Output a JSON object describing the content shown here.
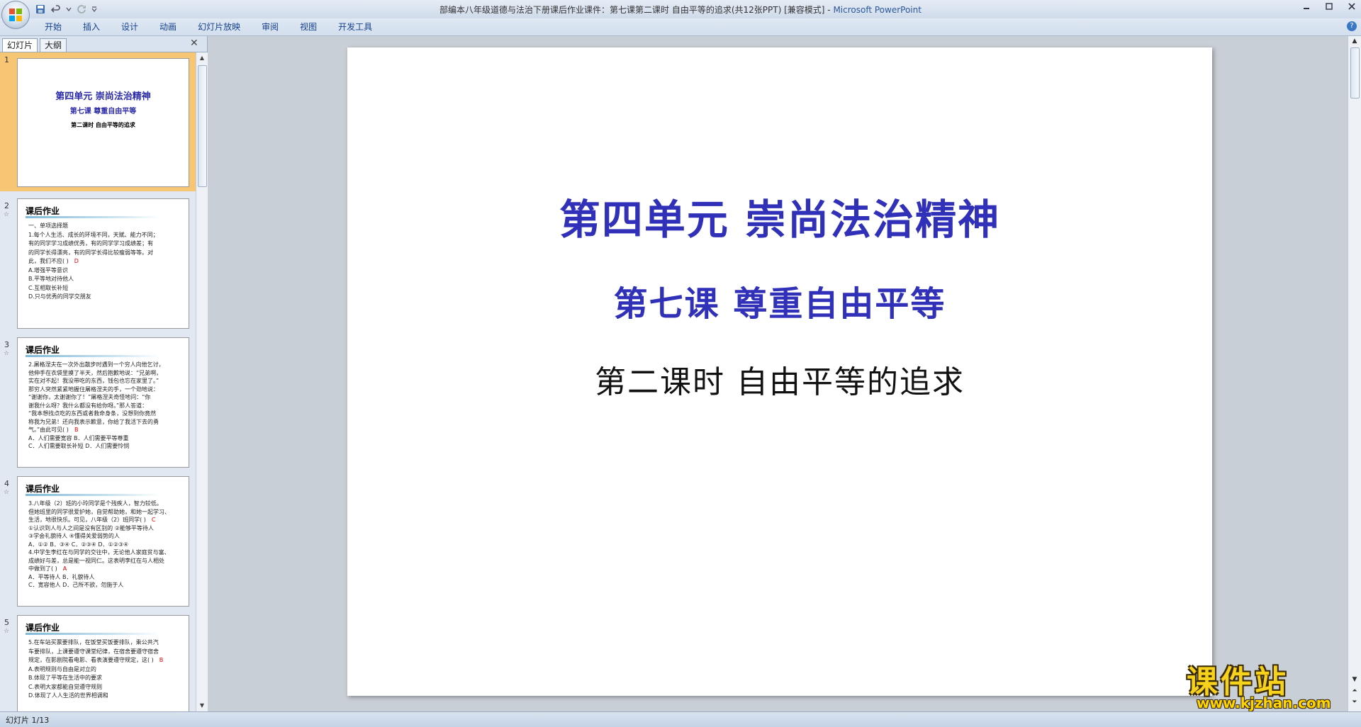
{
  "window": {
    "title": "部编本八年级道德与法治下册课后作业课件：第七课第二课时 自由平等的追求(共12张PPT) [兼容模式]",
    "app_name": "Microsoft PowerPoint"
  },
  "ribbon_tabs": [
    "开始",
    "插入",
    "设计",
    "动画",
    "幻灯片放映",
    "审阅",
    "视图",
    "开发工具"
  ],
  "pane": {
    "tab_slides": "幻灯片",
    "tab_outline": "大纲"
  },
  "thumbnails": {
    "s1": {
      "num": "1",
      "line1": "第四单元  崇尚法治精神",
      "line2": "第七课  尊重自由平等",
      "line3": "第二课时  自由平等的追求"
    },
    "s2": {
      "num": "2",
      "title": "课后作业",
      "lines": [
        "一、单项选择题",
        "1.每个人生活、成长的环境不同，天赋、能力不同；",
        "有的同学学习成绩优秀，有的同学学习成绩差；有",
        "的同学长得漂亮，有的同学长得比较瘦弱等等。对",
        "此，我们不应(      )",
        "A.增强平等意识",
        "B.平等地对待他人",
        "C.互相取长补短",
        "D.只与优秀的同学交朋友"
      ],
      "answer": "D"
    },
    "s3": {
      "num": "3",
      "title": "课后作业",
      "lines": [
        "2.屠格涅夫在一次外出散步时遇到一个穷人向他乞讨，",
        "他伸手在衣袋里摸了半天，然后抱歉地说：“兄弟啊，",
        "实在对不起！我没带吃的东西，钱包也忘在家里了。”",
        "那穷人突然紧紧地握住屠格涅夫的手，一个劲地说：",
        "“谢谢你，太谢谢你了！”屠格涅夫奇怪地问：“你",
        "谢我什么呀？我什么都没有给你呀。”那人答道：",
        "“我本想找点吃的东西或者救命身条，没想到你竟然",
        "称我为兄弟！还向我表示歉意，你给了我活下去的勇",
        "气。”由此可见(      )",
        "A．人们需要宽容        B．人们需要平等尊重",
        "C．人们需要取长补短      D．人们需要怜悯"
      ],
      "answer": "B"
    },
    "s4": {
      "num": "4",
      "title": "课后作业",
      "lines": [
        "3.八年级（2）班的小玲同学是个残疾人，智力较低。",
        "但她班里的同学很爱护她，自觉帮助她，和她一起学习、",
        "生活，地很快乐。可见，八年级（2）班同学(      )",
        "①认识到人与人之间是没有区别的   ②能够平等待人",
        "③学会礼貌待人  ④懂得关爱弱势的人",
        "A．①②   B．③④   C．②③④   D．①②③④",
        "4.中学生李红在与同学的交往中，无论他人家庭贫与富、",
        "成绩好与差，总是能一视同仁。这表明李红在与人相处",
        "中做到了(      )",
        "A．平等待人            B．礼貌待人",
        "C．宽容他人            D．己所不欲，勿施于人"
      ],
      "answer1": "C",
      "answer2": "A"
    },
    "s5": {
      "num": "5",
      "title": "课后作业",
      "lines": [
        "5.在车站买票要排队，在饭堂买饭要排队，乘公共汽",
        "车要排队，上课要遵守课堂纪律，在宿舍要遵守宿舍",
        "规定，在影剧院看电影、看表演要遵守规定，这(     )",
        "A.表明规则与自由是对立的",
        "B.体现了平等在生活中的要求",
        "C.表明大家都能自觉遵守规则",
        "D.体现了人人生活的世界相调和"
      ],
      "answer": "B"
    }
  },
  "slide": {
    "title": "第四单元   崇尚法治精神",
    "subtitle": "第七课  尊重自由平等",
    "lesson": "第二课时  自由平等的追求"
  },
  "watermark": {
    "text": "课件站",
    "url": "www.kjzhan.com"
  },
  "statusbar": {
    "text": "幻灯片 1/13"
  }
}
